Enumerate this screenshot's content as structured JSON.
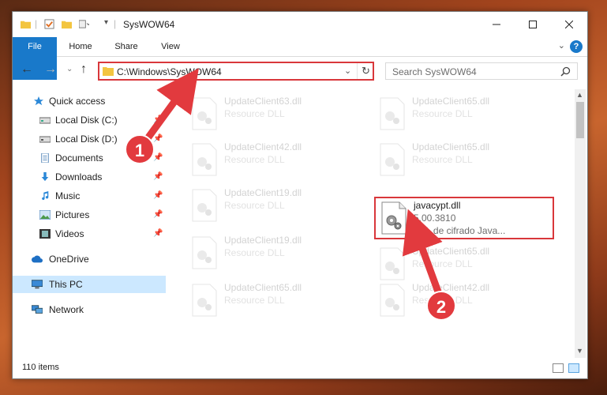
{
  "window": {
    "title": "SysWOW64"
  },
  "ribbon": {
    "tabs": [
      "File",
      "Home",
      "Share",
      "View"
    ]
  },
  "address": {
    "path": "C:\\Windows\\SysWOW64"
  },
  "search": {
    "placeholder": "Search SysWOW64"
  },
  "sidebar": {
    "items": [
      {
        "label": "Quick access",
        "icon": "star-icon"
      },
      {
        "label": "Local Disk (C:)",
        "icon": "drive-icon"
      },
      {
        "label": "Local Disk (D:)",
        "icon": "drive-icon"
      },
      {
        "label": "Documents",
        "icon": "documents-icon"
      },
      {
        "label": "Downloads",
        "icon": "download-icon"
      },
      {
        "label": "Music",
        "icon": "music-icon"
      },
      {
        "label": "Pictures",
        "icon": "pictures-icon"
      },
      {
        "label": "Videos",
        "icon": "videos-icon"
      },
      {
        "label": "OneDrive",
        "icon": "cloud-icon"
      },
      {
        "label": "This PC",
        "icon": "computer-icon"
      },
      {
        "label": "Network",
        "icon": "network-icon"
      }
    ]
  },
  "files": [
    {
      "name": "UpdateClient63.dll",
      "type": "Resource DLL"
    },
    {
      "name": "UpdateClient65.dll",
      "type": "Resource DLL"
    },
    {
      "name": "UpdateClient42.dll",
      "type": "Resource DLL"
    },
    {
      "name": "UpdateClient65.dll",
      "type": "Resource DLL"
    },
    {
      "name": "UpdateClient19.dll",
      "type": "Resource DLL"
    },
    {
      "name": "javacypt.dll",
      "type": "5.00.3810",
      "desc": "DLL de cifrado Java..."
    },
    {
      "name": "UpdateClient19.dll",
      "type": "Resource DLL"
    },
    {
      "name": "UpdateClient65.dll",
      "type": "Resource DLL"
    },
    {
      "name": "UpdateClient65.dll",
      "type": "Resource DLL"
    },
    {
      "name": "UpdateClient42.dll",
      "type": "Resource DLL"
    }
  ],
  "status": {
    "items_count": "110 items"
  },
  "annotations": {
    "step1": "1",
    "step2": "2"
  },
  "colors": {
    "accent": "#1979ca",
    "highlight": "#d9373b",
    "selected": "#cce8ff"
  }
}
